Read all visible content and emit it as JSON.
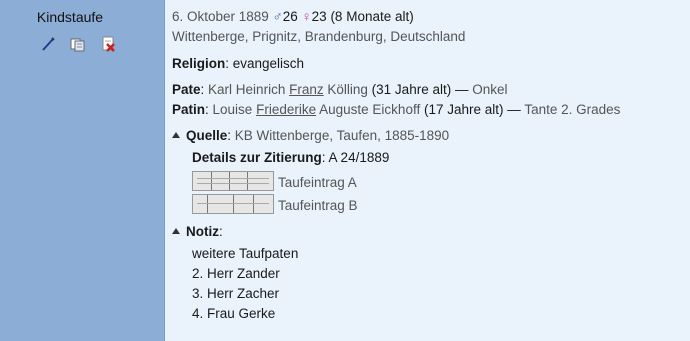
{
  "sidebar": {
    "title": "Kindstaufe",
    "actions": [
      {
        "name": "edit-icon"
      },
      {
        "name": "copy-icon"
      },
      {
        "name": "delete-icon"
      }
    ]
  },
  "event": {
    "date": "6. Oktober 1889",
    "male_symbol": "♂",
    "father_age": "26",
    "female_symbol": "♀",
    "mother_age": "23",
    "child_age": "(8 Monate alt)",
    "place": "Wittenberge, Prignitz, Brandenburg, Deutschland"
  },
  "religion": {
    "label": "Religion",
    "value": "evangelisch"
  },
  "pate": {
    "label": "Pate",
    "name_pre": "Karl Heinrich",
    "name_call": "Franz",
    "name_post": "Kölling",
    "age": "(31 Jahre alt)",
    "dash": "—",
    "relation": "Onkel"
  },
  "patin": {
    "label": "Patin",
    "name_pre": "Louise",
    "name_call": "Friederike",
    "name_post": "Auguste Eickhoff",
    "age": "(17 Jahre alt)",
    "dash": "—",
    "relation": "Tante 2. Grades"
  },
  "quelle": {
    "label": "Quelle",
    "value": "KB Wittenberge, Taufen, 1885-1890",
    "details_label": "Details zur Zitierung",
    "details_value": "A 24/1889",
    "attachments": [
      {
        "label": "Taufeintrag A"
      },
      {
        "label": "Taufeintrag B"
      }
    ]
  },
  "notiz": {
    "label": "Notiz",
    "lines": [
      "weitere Taufpaten",
      "2. Herr Zander",
      "3. Herr Zacher",
      "4. Frau Gerke"
    ]
  },
  "colors": {
    "sidebar_bg": "#8caed6",
    "content_bg": "#eaf2fb",
    "male": "#2f5f9a",
    "female": "#b54aa6"
  }
}
